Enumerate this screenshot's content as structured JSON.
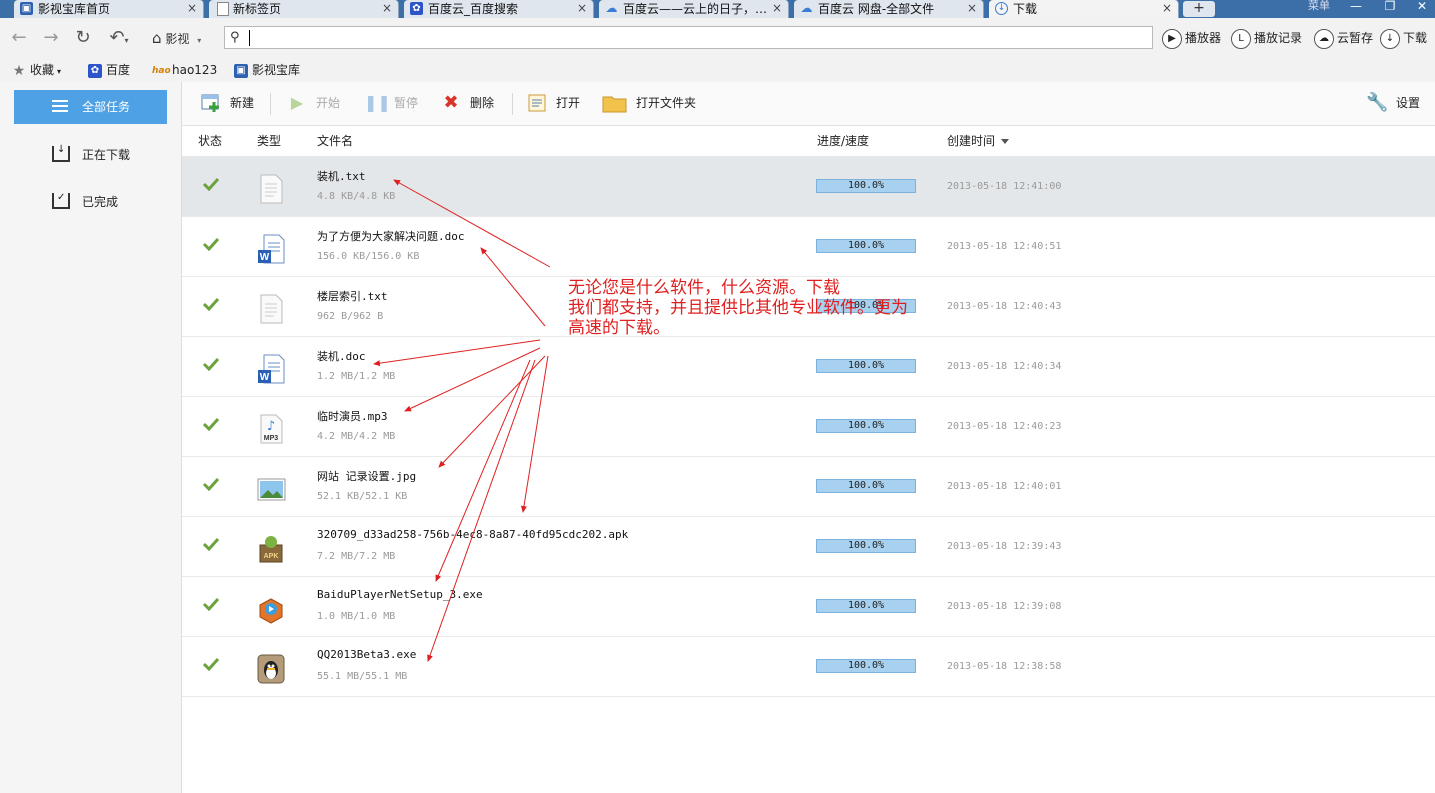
{
  "browser": {
    "tabs": [
      {
        "label": "影视宝库首页",
        "icon": "film-icon"
      },
      {
        "label": "新标签页",
        "icon": "page-icon"
      },
      {
        "label": "百度云_百度搜索",
        "icon": "baidu-paw-icon"
      },
      {
        "label": "百度云——云上的日子，…",
        "icon": "baidu-cloud-icon"
      },
      {
        "label": "百度云 网盘-全部文件",
        "icon": "baidu-cloud-icon"
      },
      {
        "label": "下载",
        "icon": "download-icon",
        "active": true
      }
    ],
    "tab_close": "×",
    "new_tab": "+",
    "menu_label": "菜单",
    "nav": {
      "home_label": "影视"
    },
    "address": {
      "value": ""
    },
    "right_tools": [
      "播放器",
      "播放记录",
      "云暂存",
      "下载"
    ],
    "bookmarks": [
      {
        "label": "收藏",
        "icon": "star-icon"
      },
      {
        "label": "百度",
        "icon": "baidu-paw-icon"
      },
      {
        "label": "hao123",
        "icon": "hao123-icon"
      },
      {
        "label": "影视宝库",
        "icon": "film-icon"
      }
    ]
  },
  "sidebar": {
    "items": [
      {
        "label": "全部任务",
        "active": true
      },
      {
        "label": "正在下载"
      },
      {
        "label": "已完成"
      }
    ]
  },
  "toolbar": {
    "new": "新建",
    "start": "开始",
    "pause": "暂停",
    "delete": "删除",
    "open": "打开",
    "open_folder": "打开文件夹",
    "settings": "设置"
  },
  "table": {
    "headers": {
      "status": "状态",
      "type": "类型",
      "filename": "文件名",
      "progress": "进度/速度",
      "created": "创建时间"
    },
    "rows": [
      {
        "name": "装机.txt",
        "size": "4.8 KB/4.8 KB",
        "progress": "100.0%",
        "progress_value": 1.0,
        "time": "2013-05-18 12:41:00",
        "icon": "txt-file-icon"
      },
      {
        "name": "为了方便为大家解决问题.doc",
        "size": "156.0 KB/156.0 KB",
        "progress": "100.0%",
        "progress_value": 1.0,
        "time": "2013-05-18 12:40:51",
        "icon": "word-file-icon"
      },
      {
        "name": "楼层索引.txt",
        "size": "962 B/962 B",
        "progress": "100.0%",
        "progress_value": 1.0,
        "time": "2013-05-18 12:40:43",
        "icon": "txt-file-icon"
      },
      {
        "name": "装机.doc",
        "size": "1.2 MB/1.2 MB",
        "progress": "100.0%",
        "progress_value": 1.0,
        "time": "2013-05-18 12:40:34",
        "icon": "word-file-icon"
      },
      {
        "name": "临时演员.mp3",
        "size": "4.2 MB/4.2 MB",
        "progress": "100.0%",
        "progress_value": 1.0,
        "time": "2013-05-18 12:40:23",
        "icon": "mp3-file-icon"
      },
      {
        "name": "网站 记录设置.jpg",
        "size": "52.1 KB/52.1 KB",
        "progress": "100.0%",
        "progress_value": 1.0,
        "time": "2013-05-18 12:40:01",
        "icon": "image-file-icon"
      },
      {
        "name": "320709_d33ad258-756b-4ec8-8a87-40fd95cdc202.apk",
        "size": "7.2 MB/7.2 MB",
        "progress": "100.0%",
        "progress_value": 1.0,
        "time": "2013-05-18 12:39:43",
        "icon": "apk-file-icon"
      },
      {
        "name": "BaiduPlayerNetSetup_3.exe",
        "size": "1.0 MB/1.0 MB",
        "progress": "100.0%",
        "progress_value": 1.0,
        "time": "2013-05-18 12:39:08",
        "icon": "baidu-player-icon"
      },
      {
        "name": "QQ2013Beta3.exe",
        "size": "55.1 MB/55.1 MB",
        "progress": "100.0%",
        "progress_value": 1.0,
        "time": "2013-05-18 12:38:58",
        "icon": "qq-penguin-icon"
      }
    ]
  },
  "annotation": {
    "lines": [
      "无论您是什么软件，什么资源。下载",
      "我们都支持，并且提供比其他专业软件。更为",
      "高速的下载。"
    ],
    "color": "#e02020"
  },
  "colors": {
    "accent": "#4da1e4",
    "check": "#6aa23c",
    "progress_fill": "#a8d0ef"
  }
}
